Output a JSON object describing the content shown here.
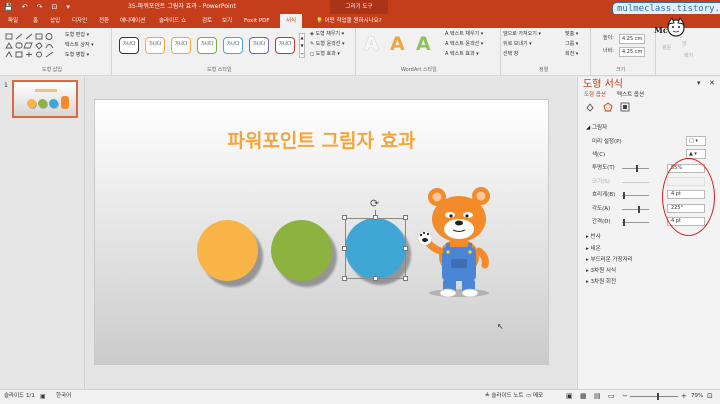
{
  "window": {
    "title": "35-파워포인트 그림자 효과 - PowerPoint",
    "drawing_tools": "그리기 도구",
    "watermark": "mulmeclass.tistory.com",
    "qat": [
      "💾",
      "↶",
      "↷",
      "⊡",
      "▾"
    ]
  },
  "menu": {
    "tabs": [
      "파일",
      "홈",
      "삽입",
      "디자인",
      "전환",
      "애니메이션",
      "슬라이드 쇼",
      "검토",
      "보기",
      "Foxit PDF",
      "서식"
    ],
    "active": "서식",
    "tell_me": "어떤 작업을 원하시나요?"
  },
  "ribbon": {
    "insert_shapes": {
      "label": "도형 삽입",
      "items": [
        "도형 편집 ▾",
        "텍스트 상자 ▾",
        "도형 병합 ▾"
      ]
    },
    "shape_styles": {
      "label": "도형 스타일",
      "swatches": [
        "가나다",
        "가나다",
        "가나다",
        "가나다",
        "가나다",
        "가나다",
        "가나다"
      ],
      "swatch_colors": [
        "#333333",
        "#f2a63c",
        "#f2a63c",
        "#70ad47",
        "#4aa3d8",
        "#7a60a8",
        "#c0392b"
      ],
      "items": [
        "도형 채우기 ▾",
        "도형 윤곽선 ▾",
        "도형 효과 ▾"
      ]
    },
    "wordart": {
      "label": "WordArt 스타일",
      "letters": [
        "A",
        "A",
        "A"
      ],
      "letter_colors": [
        "#e8e8e8",
        "#f2a63c",
        "#8fc15a"
      ],
      "items": [
        "텍스트 채우기 ▾",
        "텍스트 윤곽선 ▾",
        "텍스트 효과 ▾"
      ]
    },
    "arrange": {
      "label": "정렬",
      "items": [
        "앞으로 가져오기 ▾",
        "뒤로 보내기 ▾",
        "선택 창"
      ],
      "side": [
        "맞춤 ▾",
        "그룹 ▾",
        "회전 ▾"
      ]
    },
    "size": {
      "label": "크기",
      "height_label": "높이:",
      "height": "4.25 cm",
      "width_label": "너비:",
      "width": "4.25 cm"
    },
    "extra": [
      "광운",
      "앙",
      "배기"
    ]
  },
  "slide": {
    "number": "1",
    "title": "파워포인트 그림자 효과",
    "circles": [
      {
        "color": "#f9b447"
      },
      {
        "color": "#8db23f"
      },
      {
        "color": "#3fa7d6"
      }
    ]
  },
  "pane": {
    "title": "도형 서식",
    "tabs": [
      "도형 옵션",
      "텍스트 옵션"
    ],
    "section": "그림자",
    "preset_label": "미리 설정(P)",
    "color_label": "색(C)",
    "rows": [
      {
        "label": "투명도(T)",
        "value": "55%",
        "level": 0.55
      },
      {
        "label": "크기(S)",
        "value": "",
        "level": 0
      },
      {
        "label": "흐리게(B)",
        "value": "4 pt",
        "level": 0.04
      },
      {
        "label": "각도(A)",
        "value": "225°",
        "level": 0.625
      },
      {
        "label": "간격(D)",
        "value": "4 pt",
        "level": 0.02
      }
    ],
    "collapsed": [
      "반사",
      "네온",
      "부드러운 가장자리",
      "3차원 서식",
      "3차원 회전"
    ]
  },
  "status": {
    "slide": "슬라이드 1/1",
    "language": "한국어",
    "notes": "슬라이드 노트",
    "comments": "메모",
    "zoom": "79%"
  },
  "colors": {
    "accent": "#c43e1c",
    "annotation": "#d22222"
  }
}
